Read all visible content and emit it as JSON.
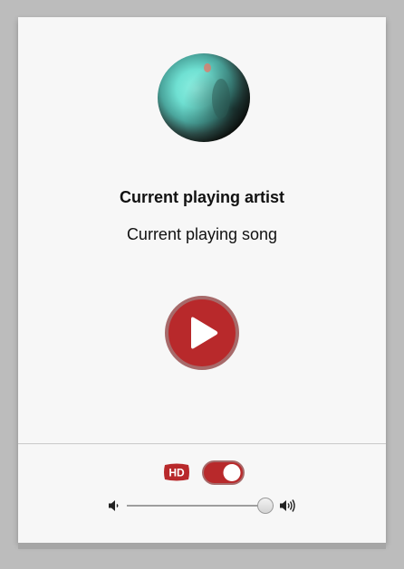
{
  "player": {
    "artist": "Current playing artist",
    "song": "Current playing song",
    "is_playing": false,
    "play_icon": "play-icon"
  },
  "settings": {
    "hd_icon": "hd-icon",
    "hd_label": "HD",
    "hd_enabled": true,
    "volume": 1.0,
    "volume_low_icon": "volume-low-icon",
    "volume_high_icon": "volume-high-icon"
  },
  "colors": {
    "accent": "#b8292b",
    "accent_border": "#a76a6a",
    "card_background": "#f7f7f7",
    "page_background": "#bcbcbc"
  }
}
